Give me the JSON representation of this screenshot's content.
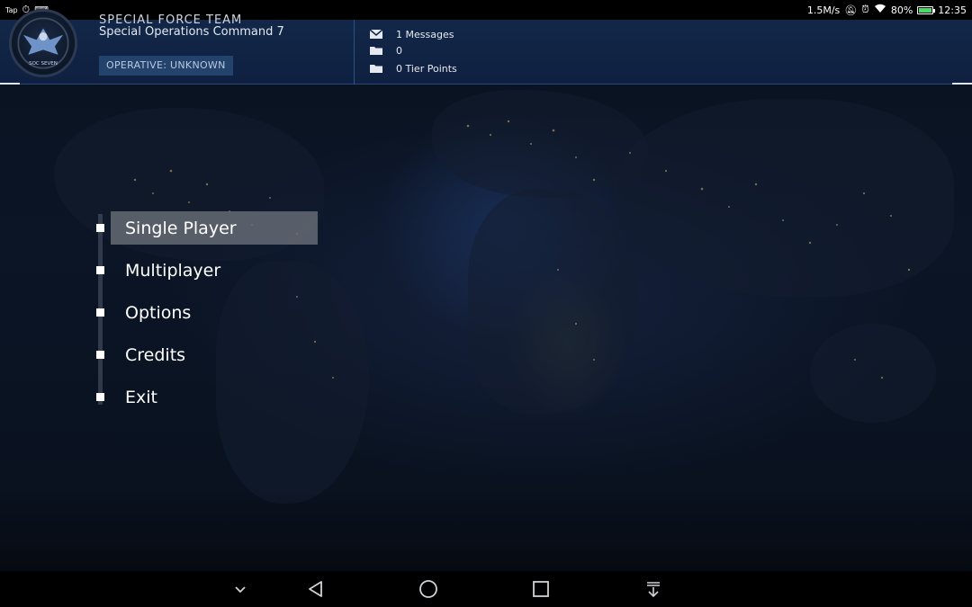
{
  "status_bar": {
    "left_label": "Tap",
    "net_speed": "1.5M/s",
    "battery": "80%",
    "time": "12:35"
  },
  "header": {
    "logo_text": "SOC SEVEN",
    "team_title": "SPECIAL FORCE TEAM",
    "subtitle": "Special Operations Command 7",
    "operative_badge": "OPERATIVE: UNKNOWN",
    "stats": [
      {
        "icon": "mail-icon",
        "text": "1 Messages"
      },
      {
        "icon": "folder-icon",
        "text": "0"
      },
      {
        "icon": "folder-icon",
        "text": "0 Tier Points"
      }
    ]
  },
  "menu": {
    "items": [
      {
        "label": "Single Player",
        "active": true
      },
      {
        "label": "Multiplayer",
        "active": false
      },
      {
        "label": "Options",
        "active": false
      },
      {
        "label": "Credits",
        "active": false
      },
      {
        "label": "Exit",
        "active": false
      }
    ]
  },
  "nav_bar": {
    "buttons": [
      "chevron-down-icon",
      "back-icon",
      "home-icon",
      "recents-icon",
      "pull-down-icon"
    ]
  },
  "colors": {
    "header_bg": "#122748",
    "badge_bg": "#23426c",
    "menu_highlight": "#696e76",
    "background": "#0a1220"
  }
}
